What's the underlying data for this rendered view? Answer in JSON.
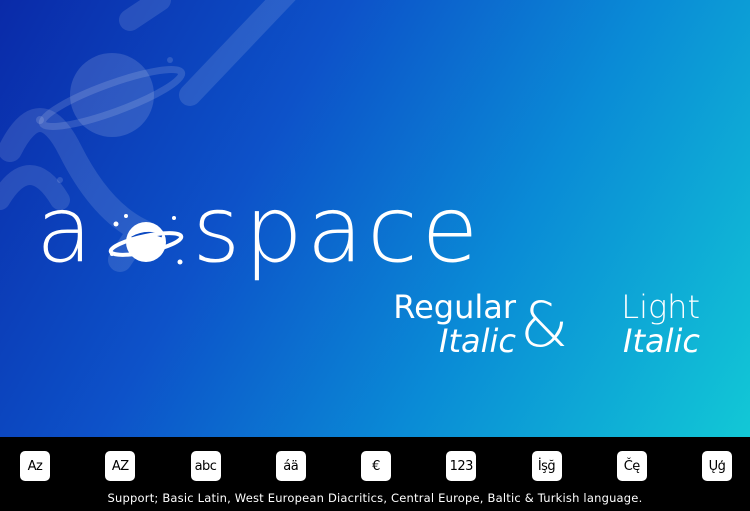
{
  "hero": {
    "brand_prefix": "a",
    "brand_suffix": "space",
    "planet_icon": "ringed-planet-icon",
    "styles": {
      "left_top": "Regular",
      "left_bottom": "Italic",
      "ampersand": "&",
      "right_top": "Light",
      "right_bottom": "Italic"
    },
    "colors": {
      "gradient_start": "#0a2aa8",
      "gradient_end": "#12c8d6",
      "text": "#ffffff"
    }
  },
  "glyph_samples": [
    "Az",
    "AZ",
    "abc",
    "áä",
    "€",
    "123",
    "İşğ",
    "Čę",
    "Ųģ"
  ],
  "support_text": "Support; Basic Latin, West European Diacritics, Central Europe, Baltic & Turkish language."
}
